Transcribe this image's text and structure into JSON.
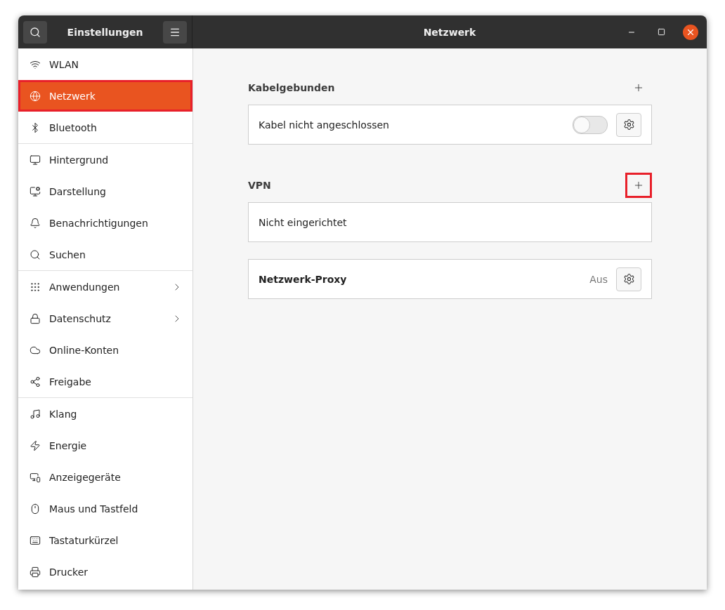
{
  "header": {
    "sidebar_title": "Einstellungen",
    "title": "Netzwerk"
  },
  "sidebar": {
    "groups": [
      [
        {
          "label": "WLAN",
          "selected": false,
          "submenu": false,
          "highlighted": false
        },
        {
          "label": "Netzwerk",
          "selected": true,
          "submenu": false,
          "highlighted": true
        },
        {
          "label": "Bluetooth",
          "selected": false,
          "submenu": false,
          "highlighted": false
        }
      ],
      [
        {
          "label": "Hintergrund",
          "selected": false,
          "submenu": false,
          "highlighted": false
        },
        {
          "label": "Darstellung",
          "selected": false,
          "submenu": false,
          "highlighted": false
        },
        {
          "label": "Benachrichtigungen",
          "selected": false,
          "submenu": false,
          "highlighted": false
        },
        {
          "label": "Suchen",
          "selected": false,
          "submenu": false,
          "highlighted": false
        }
      ],
      [
        {
          "label": "Anwendungen",
          "selected": false,
          "submenu": true,
          "highlighted": false
        },
        {
          "label": "Datenschutz",
          "selected": false,
          "submenu": true,
          "highlighted": false
        },
        {
          "label": "Online-Konten",
          "selected": false,
          "submenu": false,
          "highlighted": false
        },
        {
          "label": "Freigabe",
          "selected": false,
          "submenu": false,
          "highlighted": false
        }
      ],
      [
        {
          "label": "Klang",
          "selected": false,
          "submenu": false,
          "highlighted": false
        },
        {
          "label": "Energie",
          "selected": false,
          "submenu": false,
          "highlighted": false
        },
        {
          "label": "Anzeigegeräte",
          "selected": false,
          "submenu": false,
          "highlighted": false
        },
        {
          "label": "Maus und Tastfeld",
          "selected": false,
          "submenu": false,
          "highlighted": false
        },
        {
          "label": "Tastaturkürzel",
          "selected": false,
          "submenu": false,
          "highlighted": false
        },
        {
          "label": "Drucker",
          "selected": false,
          "submenu": false,
          "highlighted": false
        }
      ]
    ]
  },
  "sections": [
    {
      "kind": "group",
      "heading": "Kabelgebunden",
      "add_highlighted": false,
      "row": {
        "label": "Kabel nicht angeschlossen",
        "on": false
      }
    },
    {
      "kind": "group",
      "heading": "VPN",
      "add_highlighted": true,
      "row": {
        "label": "Nicht eingerichtet"
      }
    },
    {
      "kind": "proxy",
      "row": {
        "label": "Netzwerk-Proxy",
        "status": "Aus"
      }
    }
  ]
}
